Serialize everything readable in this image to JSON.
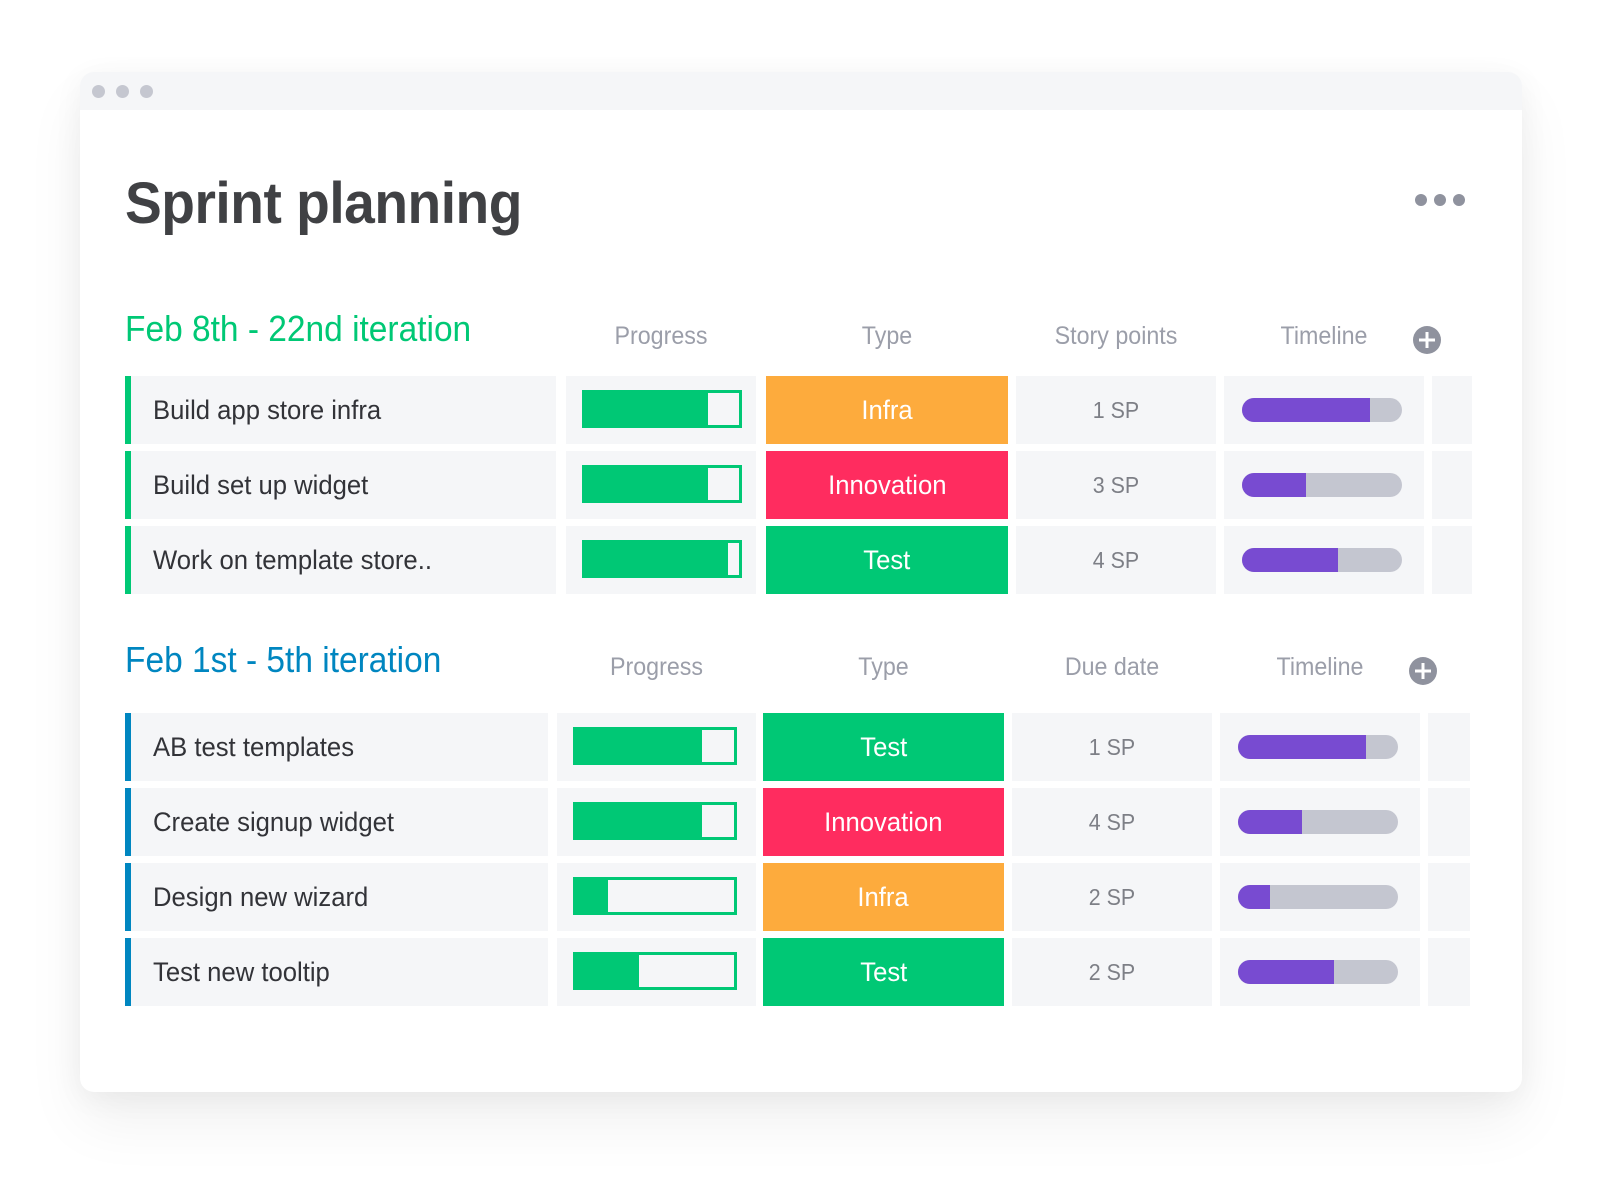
{
  "window": {
    "title": "Sprint planning",
    "more_icon": "more-horizontal-icon"
  },
  "colors": {
    "progress": "#00c875",
    "timeline_fill": "#784bd1",
    "timeline_track": "#c4c6d0",
    "type_colors": {
      "Infra": "#fdab3d",
      "Innovation": "#ff2c5f",
      "Test": "#00c875"
    }
  },
  "groups": [
    {
      "title": "Feb 8th - 22nd iteration",
      "color": "#00c875",
      "columns": [
        "Progress",
        "Type",
        "Story points",
        "Timeline"
      ],
      "add_column_icon": "plus-circle-icon",
      "rows": [
        {
          "name": "Build app store infra",
          "progress": 0.8,
          "type": "Infra",
          "points": "1 SP",
          "timeline": 0.8
        },
        {
          "name": "Build set up widget",
          "progress": 0.8,
          "type": "Innovation",
          "points": "3 SP",
          "timeline": 0.4
        },
        {
          "name": "Work on template store..",
          "progress": 0.93,
          "type": "Test",
          "points": "4 SP",
          "timeline": 0.6
        }
      ]
    },
    {
      "title": "Feb 1st - 5th iteration",
      "color": "#0086c0",
      "columns": [
        "Progress",
        "Type",
        "Due date",
        "Timeline"
      ],
      "add_column_icon": "plus-circle-icon",
      "rows": [
        {
          "name": "AB test templates",
          "progress": 0.8,
          "type": "Test",
          "points": "1 SP",
          "timeline": 0.8
        },
        {
          "name": "Create signup widget",
          "progress": 0.8,
          "type": "Innovation",
          "points": "4 SP",
          "timeline": 0.4
        },
        {
          "name": "Design new wizard",
          "progress": 0.2,
          "type": "Infra",
          "points": "2 SP",
          "timeline": 0.2
        },
        {
          "name": "Test new tooltip",
          "progress": 0.4,
          "type": "Test",
          "points": "2 SP",
          "timeline": 0.6
        }
      ]
    }
  ]
}
